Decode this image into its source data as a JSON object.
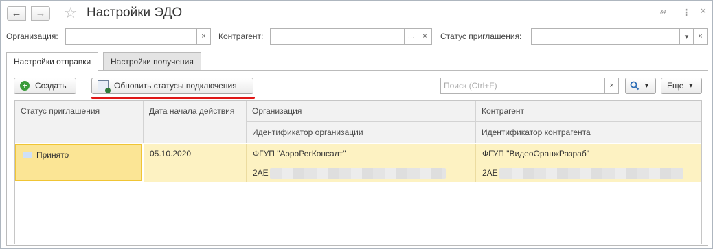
{
  "window": {
    "title": "Настройки ЭДО"
  },
  "filters": {
    "organization_label": "Организация:",
    "counterparty_label": "Контрагент:",
    "invitation_status_label": "Статус приглашения:",
    "organization_value": "",
    "counterparty_value": "",
    "invitation_status_value": ""
  },
  "tabs": [
    {
      "label": "Настройки отправки",
      "active": true
    },
    {
      "label": "Настройки получения",
      "active": false
    }
  ],
  "toolbar": {
    "create_label": "Создать",
    "update_label": "Обновить статусы подключения",
    "more_label": "Еще",
    "search_placeholder": "Поиск (Ctrl+F)"
  },
  "table": {
    "headers": {
      "status": "Статус приглашения",
      "start_date": "Дата начала действия",
      "organization": "Организация",
      "organization_id": "Идентификатор организации",
      "counterparty": "Контрагент",
      "counterparty_id": "Идентификатор контрагента"
    },
    "rows": [
      {
        "status": "Принято",
        "start_date": "05.10.2020",
        "organization": "ФГУП \"АэроРегКонсалт\"",
        "organization_id": "2AE",
        "counterparty": "ФГУП \"ВидеоОранжРазраб\"",
        "counterparty_id": "2AE"
      }
    ]
  },
  "icons": {
    "back": "←",
    "forward": "→",
    "star": "☆",
    "link": "🔗",
    "menu": "⋮",
    "close": "×",
    "clear": "×",
    "dots": "...",
    "dropdown": "▾",
    "search": "🔍"
  },
  "colors": {
    "selected_row": "#fdf2c2",
    "selected_cell_border": "#f0c535",
    "highlight_underline": "#e01818",
    "create_icon": "#3b9b3b"
  }
}
